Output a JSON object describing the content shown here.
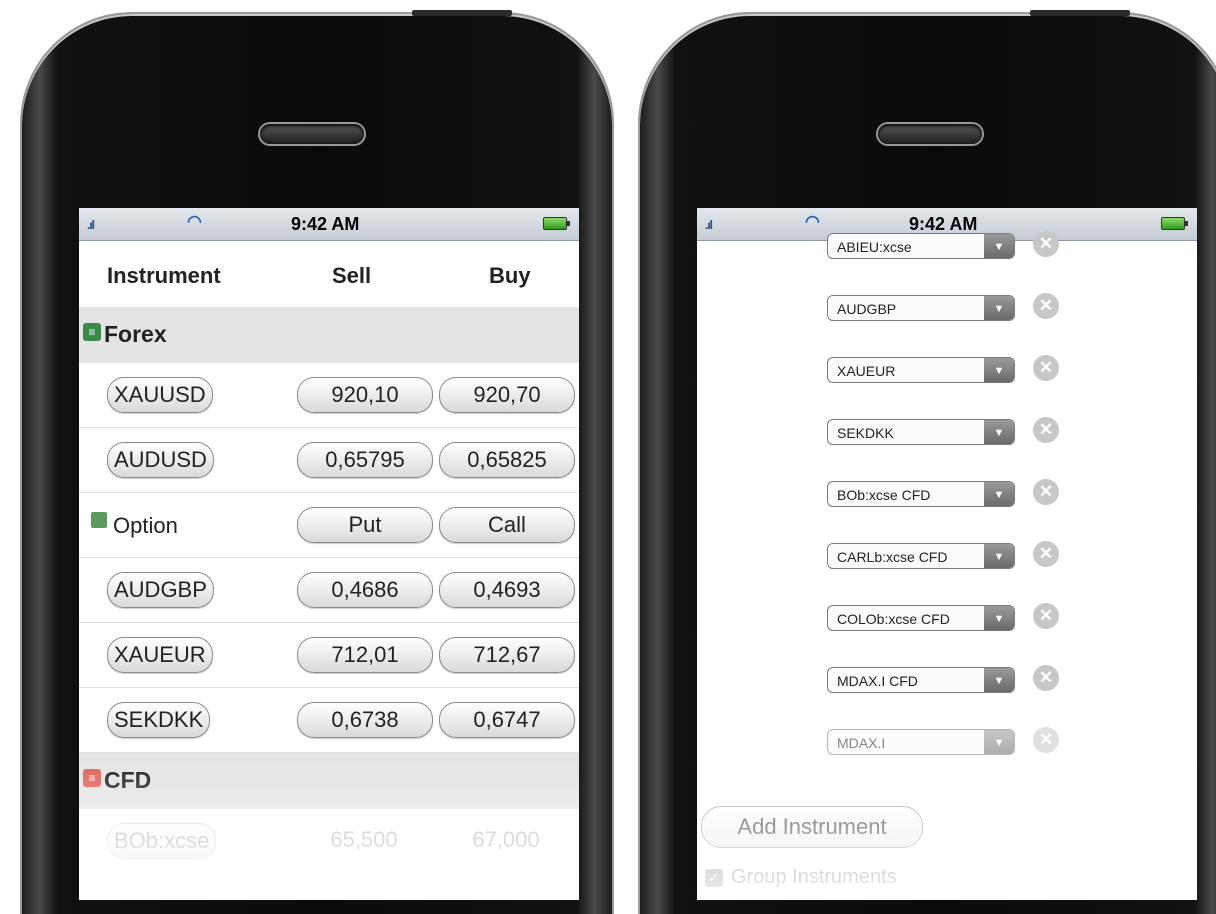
{
  "status_bar": {
    "time": "9:42 AM",
    "signal": ".ıl",
    "wifi": "≈"
  },
  "left_screen": {
    "headers": {
      "instrument": "Instrument",
      "sell": "Sell",
      "buy": "Buy"
    },
    "sections": [
      {
        "label": "Forex",
        "icon": "forex-icon",
        "color": "#3a8a4a"
      },
      {
        "label": "CFD",
        "icon": "cfd-icon",
        "color": "#e0645a"
      }
    ],
    "forex_rows": [
      {
        "instrument": "XAUUSD",
        "sell": "920,10",
        "buy": "920,70"
      },
      {
        "instrument": "AUDUSD",
        "sell": "0,65795",
        "buy": "0,65825"
      }
    ],
    "option_row": {
      "label": "Option",
      "sell": "Put",
      "buy": "Call"
    },
    "forex_rows_2": [
      {
        "instrument": "AUDGBP",
        "sell": "0,4686",
        "buy": "0,4693"
      },
      {
        "instrument": "XAUEUR",
        "sell": "712,01",
        "buy": "712,67"
      },
      {
        "instrument": "SEKDKK",
        "sell": "0,6738",
        "buy": "0,6747"
      }
    ],
    "cfd_rows": [
      {
        "instrument": "BOb:xcse",
        "sell": "65,500",
        "buy": "67,000"
      }
    ]
  },
  "right_screen": {
    "instruments": [
      "ABIEU:xcse",
      "AUDGBP",
      "XAUEUR",
      "SEKDKK",
      "BOb:xcse CFD",
      "CARLb:xcse CFD",
      "COLOb:xcse CFD",
      "MDAX.I CFD",
      "MDAX.I"
    ],
    "add_button": "Add Instrument",
    "group_checkbox": "Group Instruments",
    "dropdown_arrow": "▼",
    "remove_glyph": "✕",
    "check_glyph": "✓"
  }
}
